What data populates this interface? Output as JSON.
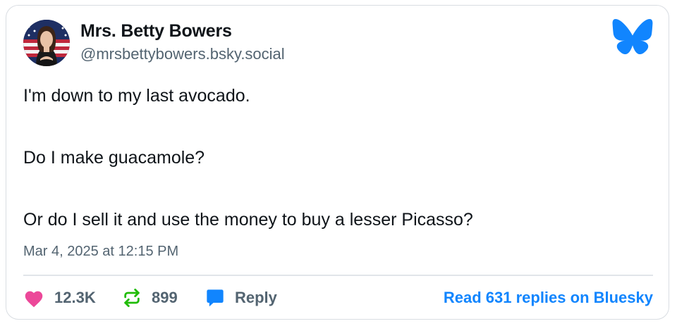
{
  "author": {
    "name": "Mrs. Betty Bowers",
    "handle": "@mrsbettybowers.bsky.social"
  },
  "post": {
    "lines": [
      "I'm down to my last avocado.",
      "Do I make guacamole?",
      "Or do I sell it and use the money to buy a lesser Picasso?"
    ],
    "timestamp": "Mar 4, 2025 at 12:15 PM"
  },
  "stats": {
    "likes": "12.3K",
    "reposts": "899",
    "reply_label": "Reply",
    "read_replies": "Read 631 replies on Bluesky"
  },
  "icons": {
    "logo": "bluesky-butterfly-icon",
    "like": "heart-icon",
    "repost": "repost-icon",
    "reply": "speech-bubble-icon"
  },
  "colors": {
    "brand": "#1185fe",
    "like": "#ec4899",
    "repost": "#20bc07",
    "reply": "#1185fe",
    "text": "#0f1419",
    "muted": "#536471"
  }
}
